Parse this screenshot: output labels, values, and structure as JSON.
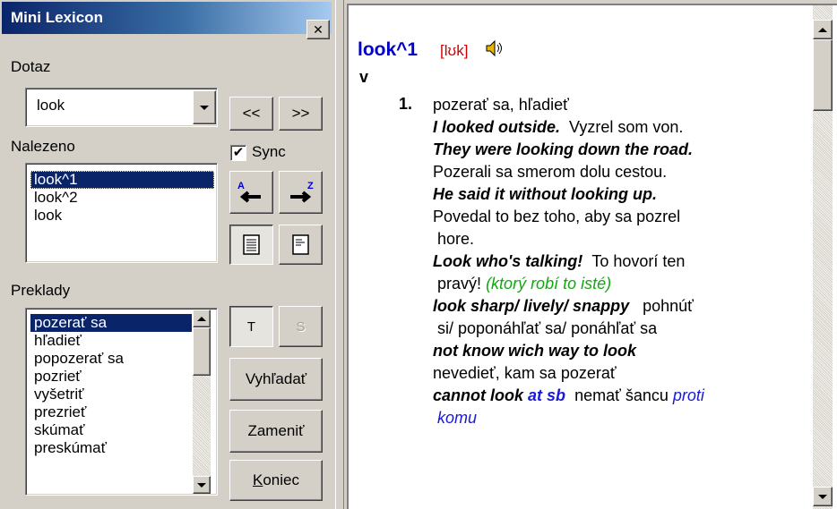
{
  "window": {
    "title": "Mini Lexicon",
    "close_label": "✕"
  },
  "query": {
    "label": "Dotaz",
    "value": "look",
    "prev_label": "<<",
    "next_label": ">>"
  },
  "found": {
    "label": "Nalezeno",
    "sync_label": "Sync",
    "sync_checked": true,
    "items": [
      "look^1",
      "look^2",
      "look"
    ]
  },
  "translations": {
    "label": "Preklady",
    "items": [
      "pozerať sa",
      "hľadieť",
      "popozerať sa",
      "pozrieť",
      "vyšetriť",
      "prezrieť",
      "skúmať",
      "preskúmať"
    ]
  },
  "buttons": {
    "t_label": "T",
    "s_label": "S",
    "search_label": "Vyhľadať",
    "replace_label": "Zameniť",
    "end_label": "Koniec",
    "end_accel": "K",
    "end_rest": "oniec"
  },
  "entry": {
    "headword": "look^1",
    "pronunciation": "[lʊk]",
    "pos": "v",
    "sense_number": "1.",
    "sense_text": "pozerať sa, hľadieť",
    "lines": {
      "l1_ex": "I looked outside.",
      "l1_tr": "Vyzrel som von.",
      "l2_ex": "They were looking down the road.",
      "l3_tr": "Pozerali sa smerom dolu cestou.",
      "l4_ex": "He said it without looking up.",
      "l5_tr": "Povedal to bez toho, aby sa pozrel",
      "l6_tr": "hore.",
      "l7_ex": "Look who's talking!",
      "l7_tr": "To hovorí ten",
      "l8_tr": "pravý!",
      "l8_note": "(ktorý robí to isté)",
      "l9_ex": "look sharp/ lively/ snappy",
      "l9_tr": "pohnúť",
      "l10_tr": "si/ poponáhľať sa/ ponáhľať sa",
      "l11_ex": "not know wich way to look",
      "l12_tr": "nevedieť, kam sa pozerať",
      "l13_ex": "cannot look",
      "l13_ex2": "at sb",
      "l13_tr": "nemať šancu",
      "l13_note": "proti",
      "l14_note": "komu"
    }
  },
  "colors": {
    "titlebar_start": "#0a246a",
    "headword": "#0000cc",
    "pronunciation": "#cc0000",
    "note_green": "#11a811",
    "note_blue": "#1a1ad6",
    "selection": "#0a246a"
  }
}
